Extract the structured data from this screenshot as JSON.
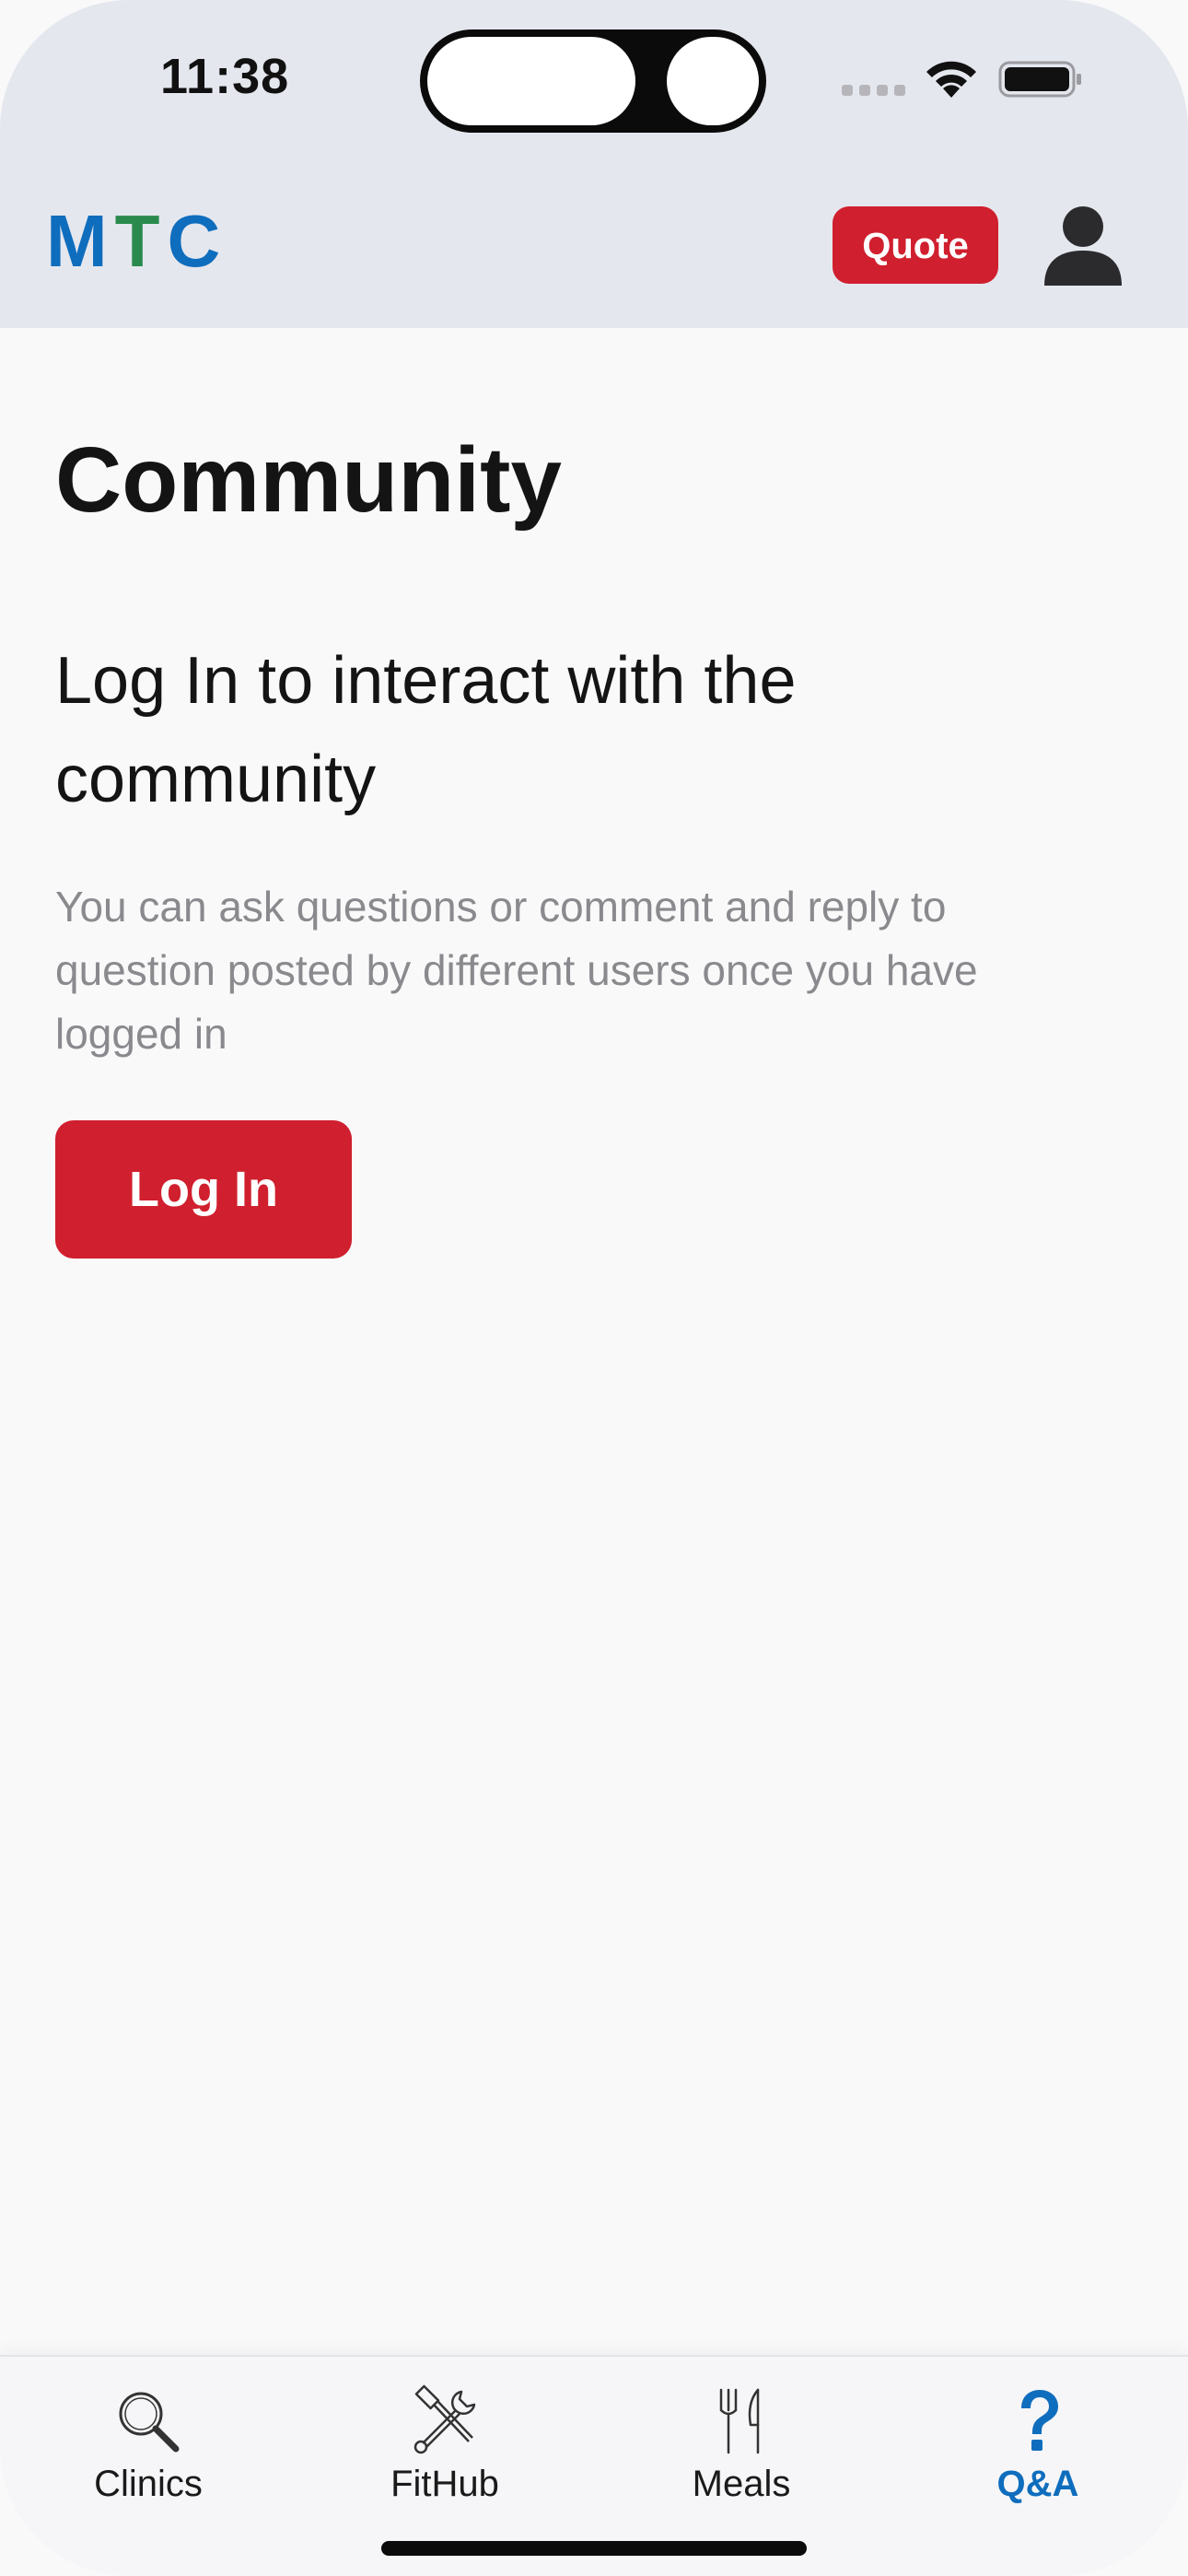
{
  "status_bar": {
    "time": "11:38"
  },
  "header": {
    "brand": {
      "m": "M",
      "t": "T",
      "c": "C"
    },
    "quote_label": "Quote",
    "profile_icon": "person-icon"
  },
  "main": {
    "title": "Community",
    "login_heading": "Log In to interact with the community",
    "login_description": "You can ask questions or comment and reply to question posted by different users once you have logged in",
    "login_button": "Log In"
  },
  "tabbar": {
    "active": "Q&A",
    "tabs": [
      {
        "label": "Clinics",
        "icon": "search-icon"
      },
      {
        "label": "FitHub",
        "icon": "hammer-wrench-icon"
      },
      {
        "label": "Meals",
        "icon": "fork-knife-icon"
      },
      {
        "label": "Q&A",
        "icon": "question-icon"
      }
    ]
  },
  "colors": {
    "accent_red": "#d01f2e",
    "brand_blue": "#0f6dbd",
    "brand_green": "#2a8a4e",
    "header_bg": "#e5e7ee",
    "page_bg": "#f9f9fa",
    "muted_text": "#8a8a8e"
  }
}
